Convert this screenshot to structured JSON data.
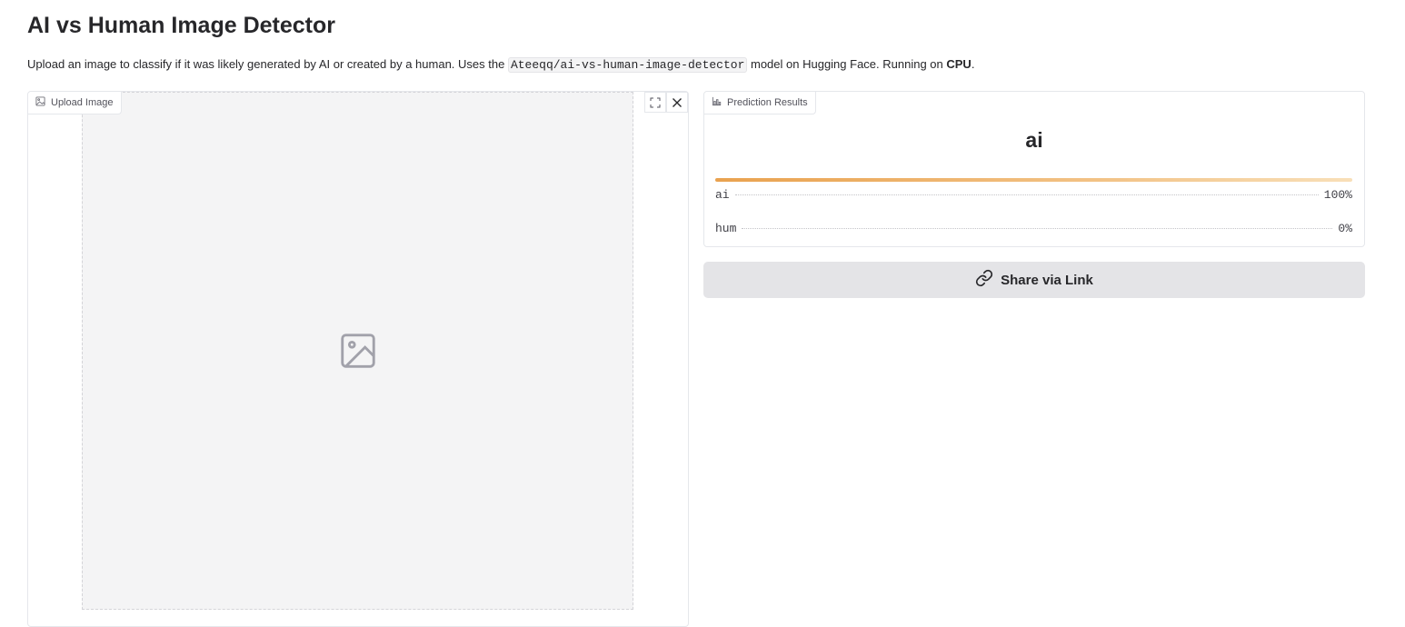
{
  "header": {
    "title": "AI vs Human Image Detector",
    "description_prefix": "Upload an image to classify if it was likely generated by AI or created by a human. Uses the ",
    "model_name": "Ateeqq/ai-vs-human-image-detector",
    "description_mid": " model on Hugging Face. Running on ",
    "device": "CPU",
    "description_suffix": "."
  },
  "upload": {
    "label": "Upload Image",
    "image_icon": "image-icon",
    "fullscreen_icon": "fullscreen-icon",
    "close_icon": "close-icon"
  },
  "results": {
    "label": "Prediction Results",
    "label_icon": "bar-chart-icon",
    "top_label": "ai",
    "confidences": [
      {
        "label": "ai",
        "value": "100%",
        "fraction": 1.0
      },
      {
        "label": "hum",
        "value": "0%",
        "fraction": 0.0
      }
    ]
  },
  "share": {
    "label": "Share via Link",
    "icon": "link-icon"
  },
  "colors": {
    "bar_start": "#e9a24f",
    "bar_end": "#f8dfb8",
    "share_bg": "#e4e4e7"
  }
}
